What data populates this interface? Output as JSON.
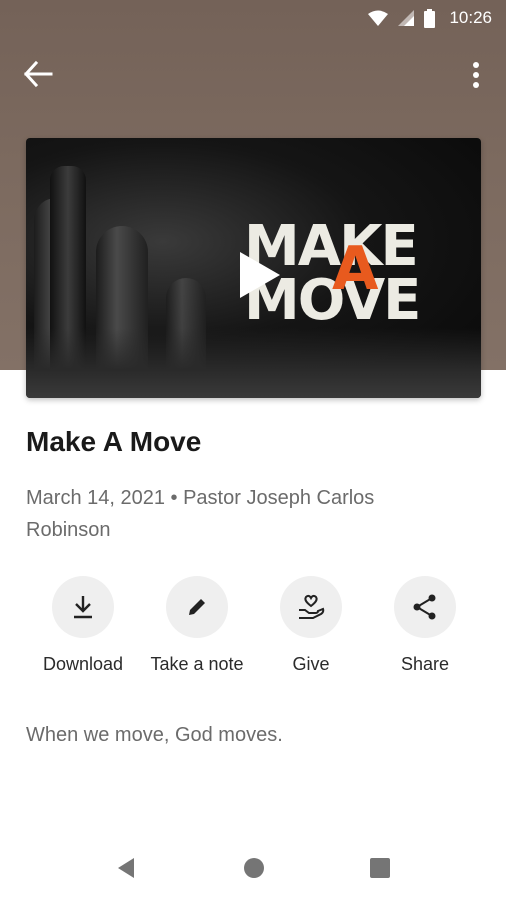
{
  "status_bar": {
    "time": "10:26",
    "icons": [
      "wifi-icon",
      "signal-icon",
      "battery-icon"
    ]
  },
  "toolbar": {
    "back_icon": "arrow-back-icon",
    "more_icon": "more-vert-icon"
  },
  "artwork": {
    "title_line1": "MAKE",
    "title_accent": "A",
    "title_line2": "MOVE",
    "accent_color": "#e85a1e",
    "play_icon": "play-icon",
    "audio_icon": "headphones-icon"
  },
  "sermon": {
    "title": "Make A Move",
    "meta": "March 14, 2021 • Pastor Joseph Carlos Robinson",
    "description": "When we move, God moves."
  },
  "actions": [
    {
      "label": "Download",
      "icon": "download-icon"
    },
    {
      "label": "Take a note",
      "icon": "pencil-icon"
    },
    {
      "label": "Give",
      "icon": "give-hand-heart-icon"
    },
    {
      "label": "Share",
      "icon": "share-icon"
    }
  ],
  "nav_bar": {
    "icons": [
      "back-triangle-icon",
      "home-circle-icon",
      "recents-square-icon"
    ]
  },
  "colors": {
    "header_bg": "#7a685d",
    "action_bg": "#efefef",
    "text_secondary": "#6b6b6b"
  }
}
